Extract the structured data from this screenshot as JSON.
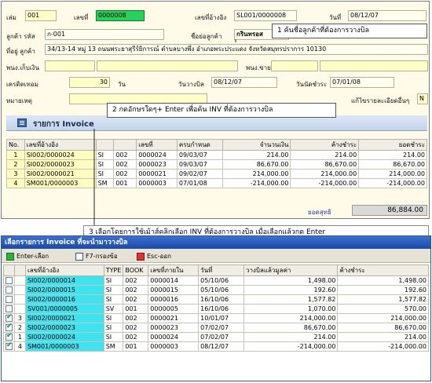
{
  "form": {
    "book_label": "เล่ม",
    "book_value": "001",
    "number_label": "เลขที่",
    "number_value": "0000008",
    "ref_label": "เลขที่อ้างอิง",
    "ref_value": "SL001/0000008",
    "date_label": "วันที่",
    "date_value": "08/12/07",
    "customer_code_label": "ลูกค้า รหัส",
    "customer_code_value": "ก-001",
    "customer_name_label": "ชื่อย่อลูกค้า",
    "customer_name_value": "กรินทรอส",
    "address_label": "ที่อยู่ ลูกค้า",
    "address_value": "34/13-14 หมู่ 13 ถนนพระยาสุรีร์ยิการณ์ ตำบลบางพึ่ง อำเภอพระประแดง จังหวัดสมุทรปราการ 10130",
    "collector_label": "พนง.เก็บเงิน",
    "sales_label": "พนง.ขาย",
    "credit_label": "เครดิตเทอม",
    "credit_value": "30",
    "credit_unit": "วัน",
    "bill_date_label": "วันวางบิล",
    "bill_date_value": "08/12/07",
    "due_date_label": "วันนัดชำระ",
    "due_date_value": "07/01/08",
    "note_label": "หมายเหตุ",
    "edit_label": "แก้ไขรายละเอียดอื่นๆ",
    "edit_value": "N"
  },
  "callouts": {
    "c1": "1 ค้นชื่อลูกค้าที่ต้องการวางบิล",
    "c2": "2 กดอักษรใดๆ+ Enter เพื่อค้น INV ที่ต้องการวางบิล",
    "c3": "3 เลือกโดยการใช้เม้าส์คลิกเลือก INV ที่ต้องการวางบิล เมื่อเลือกแล้วกด Enter"
  },
  "invoice": {
    "title": "รายการ Invoice",
    "headers": [
      "No.",
      "เลขที่อ้างอิง",
      "",
      "เลขที่",
      "ครบกำหนด",
      "จำนวนเงิน",
      "ค้างชำระ",
      "ยอดชำระ"
    ],
    "rows": [
      {
        "no": "1",
        "ref": "SI002/0000024",
        "type": "SI",
        "book": "002",
        "doc": "0000024",
        "due": "09/03/07",
        "amount": "214.00",
        "outstanding": "214.00",
        "pay": "214.00"
      },
      {
        "no": "2",
        "ref": "SI002/0000023",
        "type": "SI",
        "book": "002",
        "doc": "0000023",
        "due": "09/03/07",
        "amount": "86,670.00",
        "outstanding": "86,670.00",
        "pay": "86,670.00"
      },
      {
        "no": "3",
        "ref": "SI002/0000021",
        "type": "SI",
        "book": "002",
        "doc": "0000021",
        "due": "09/02/07",
        "amount": "214,000.00",
        "outstanding": "214,000.00",
        "pay": "214,000.00"
      },
      {
        "no": "4",
        "ref": "SM001/0000003",
        "type": "SM",
        "book": "001",
        "doc": "0000003",
        "due": "07/01/08",
        "amount": "-214,000.00",
        "outstanding": "-214,000.00",
        "pay": "-214,000.00"
      }
    ],
    "total_label": "ยอดสุทธิ",
    "total_value": "86,884.00"
  },
  "dialog": {
    "title": "เลือกรายการ Invoice ที่จะนำมาวางบิล",
    "enter_label": "Enter-เลือก",
    "f7_label": "F7-กรองข้อ",
    "esc_label": "Esc-ออก",
    "headers": [
      "",
      "",
      "เลขที่อ้างอิง",
      "TYPE",
      "BOOK",
      "เลขที่ภายใน",
      "วันที่",
      "วางบิลแล้วมูลค่า",
      "ค้างชำระ"
    ],
    "rows": [
      {
        "checked": false,
        "seq": "",
        "ref": "SI002/0000014",
        "type": "SI",
        "book": "002",
        "doc": "0000014",
        "date": "05/10/06",
        "billed": "1,498.00",
        "outstanding": "1,498.00"
      },
      {
        "checked": false,
        "seq": "",
        "ref": "SI002/0000015",
        "type": "SI",
        "book": "002",
        "doc": "0000015",
        "date": "05/10/06",
        "billed": "192.60",
        "outstanding": "192.60"
      },
      {
        "checked": false,
        "seq": "",
        "ref": "SI002/0000016",
        "type": "SI",
        "book": "002",
        "doc": "0000016",
        "date": "16/10/06",
        "billed": "1,577.82",
        "outstanding": "1,577.82"
      },
      {
        "checked": false,
        "seq": "",
        "ref": "SV001/0000005",
        "type": "SV",
        "book": "001",
        "doc": "0000005",
        "date": "16/10/06",
        "billed": "1,070.00",
        "outstanding": "570.00"
      },
      {
        "checked": true,
        "seq": "3",
        "ref": "SI002/0000021",
        "type": "SI",
        "book": "002",
        "doc": "0000021",
        "date": "10/01/07",
        "billed": "214,000.00",
        "outstanding": "214,000.00"
      },
      {
        "checked": true,
        "seq": "2",
        "ref": "SI002/0000023",
        "type": "SI",
        "book": "002",
        "doc": "0000023",
        "date": "07/02/07",
        "billed": "86,670.00",
        "outstanding": "86,670.00"
      },
      {
        "checked": true,
        "seq": "1",
        "ref": "SI002/0000024",
        "type": "SI",
        "book": "002",
        "doc": "0000024",
        "date": "07/02/07",
        "billed": "214.00",
        "outstanding": "214.00"
      },
      {
        "checked": true,
        "seq": "4",
        "ref": "SM001/0000003",
        "type": "SM",
        "book": "001",
        "doc": "0000003",
        "date": "08/12/07",
        "billed": "-214,000.00",
        "outstanding": "-214,000.00"
      }
    ]
  }
}
